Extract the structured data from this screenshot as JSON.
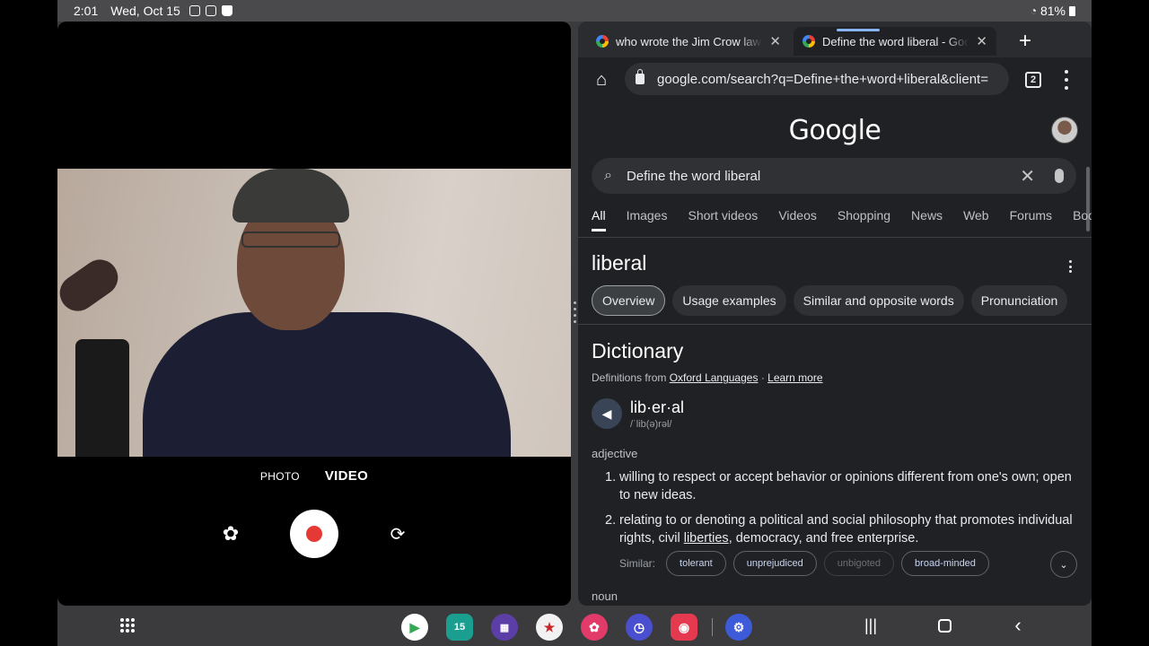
{
  "status_bar": {
    "time": "2:01",
    "date": "Wed, Oct 15",
    "battery": "81%"
  },
  "camera": {
    "modes": [
      "PHOTO",
      "VIDEO"
    ],
    "active_mode": "VIDEO",
    "icons": {
      "effects": "flower-icon",
      "record": "record-icon",
      "switch": "switch-camera-icon"
    }
  },
  "browser": {
    "tabs": [
      {
        "title": "who wrote the Jim Crow laws"
      },
      {
        "title": "Define the word liberal - Google Search"
      }
    ],
    "url": "google.com/search?q=Define+the+word+liberal&client=",
    "tab_count": "2",
    "logo": "Google",
    "search_query": "Define the word liberal",
    "nav_tabs": [
      "All",
      "Images",
      "Short videos",
      "Videos",
      "Shopping",
      "News",
      "Web",
      "Forums",
      "Boo"
    ],
    "term": "liberal",
    "term_chips": [
      "Overview",
      "Usage examples",
      "Similar and opposite words",
      "Pronunciation"
    ],
    "dictionary": {
      "heading": "Dictionary",
      "definitions_from": "Definitions from",
      "source": "Oxford Languages",
      "separator": "·",
      "learn_more": "Learn more",
      "word": "lib·er·al",
      "phonetic": "/ˈlib(ə)rəl/",
      "part_of_speech": "adjective",
      "def1_num": "1.",
      "def1": "willing to respect or accept behavior or opinions different from one's own; open to new ideas.",
      "def2_num": "2.",
      "def2_pre": "relating to or denoting a political and social philosophy that promotes individual rights, civil ",
      "def2_link": "liberties",
      "def2_post": ", democracy, and free enterprise.",
      "similar_label": "Similar:",
      "similar": [
        "tolerant",
        "unprejudiced",
        "unbigoted",
        "broad-minded"
      ],
      "next_pos": "noun"
    }
  },
  "dock": {
    "apps": [
      "play-store-icon",
      "calendar-icon",
      "apps-folder-icon",
      "chrome-extension-icon",
      "photos-icon",
      "clock-icon",
      "screen-recorder-icon",
      "settings-icon"
    ],
    "calendar_day": "15"
  },
  "colors": {
    "record_red": "#e53935",
    "link_blue": "#c6d4f6",
    "browser_bg": "#202124"
  }
}
